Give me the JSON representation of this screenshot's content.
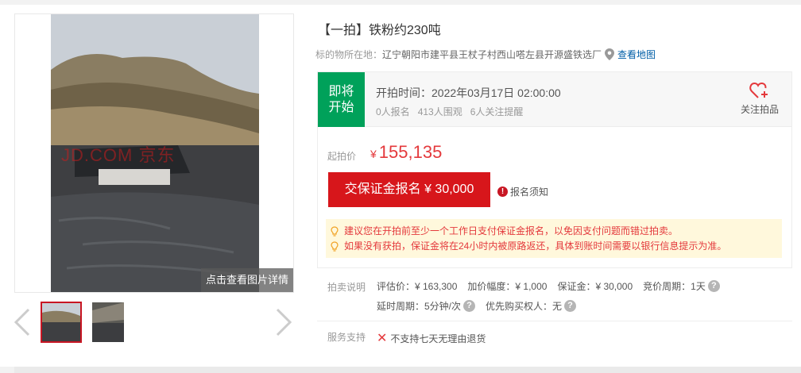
{
  "gallery": {
    "watermark": "JD.COM 京东",
    "detail_link": "点击查看图片详情"
  },
  "item": {
    "title": "【一拍】铁粉约230吨",
    "location_label": "标的物所在地：",
    "location": "辽宁朝阳市建平县王杖子村西山嗒左县开源盛铁选厂",
    "map_link": "查看地图"
  },
  "status": {
    "badge_line1": "即将",
    "badge_line2": "开始",
    "start_time": "开拍时间：2022年03月17日 02:00:00",
    "signups": "0人报名",
    "watchers": "413人围观",
    "reminders": "6人关注提醒",
    "follow_label": "关注拍品"
  },
  "pricing": {
    "start_price_label": "起拍价",
    "currency": "¥",
    "start_price": "155,135",
    "deposit_button": "交保证金报名 ¥ 30,000",
    "notice_link": "报名须知"
  },
  "tips": [
    "建议您在开拍前至少一个工作日支付保证金报名，以免因支付问题而错过拍卖。",
    "如果没有获拍，保证金将在24小时内被原路返还，具体到账时间需要以银行信息提示为准。"
  ],
  "auction_info": {
    "label": "拍卖说明",
    "valuation": "评估价：¥ 163,300",
    "increment": "加价幅度：¥ 1,000",
    "deposit": "保证金：¥ 30,000",
    "cycle": "竞价周期：1天",
    "delay": "延时周期：5分钟/次",
    "priority": "优先购买权人：无"
  },
  "service": {
    "label": "服务支持",
    "value": "不支持七天无理由退货"
  },
  "colors": {
    "accent_red": "#d7161b",
    "status_green": "#00a15a",
    "price_red": "#e4393c",
    "link_blue": "#005ea7"
  }
}
